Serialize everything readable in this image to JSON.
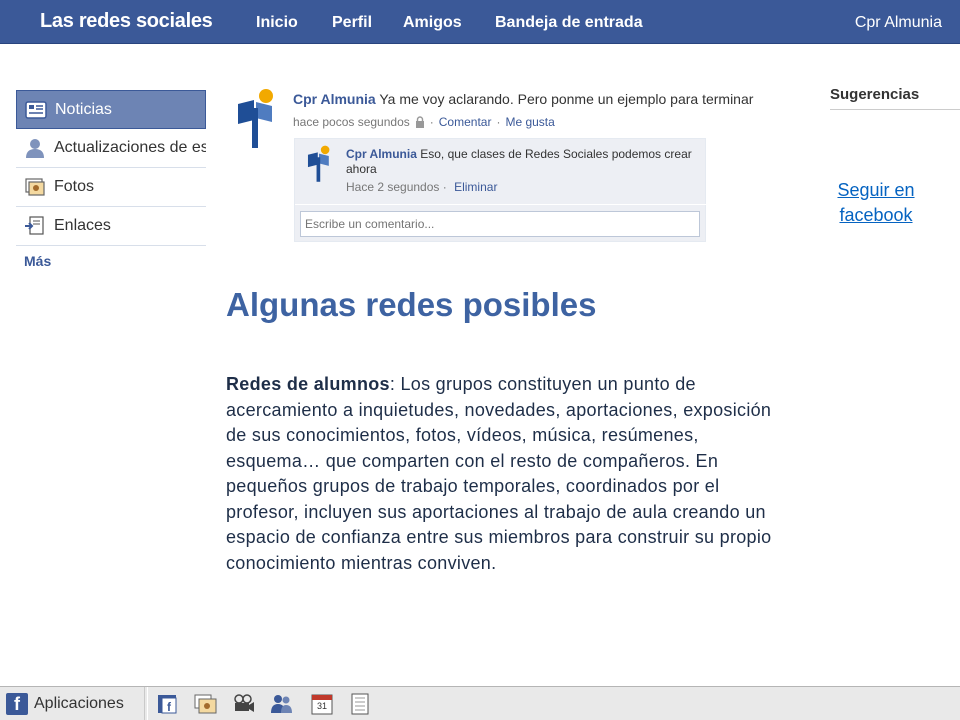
{
  "topbar": {
    "brand": "Las redes sociales",
    "nav": [
      "Inicio",
      "Perfil",
      "Amigos",
      "Bandeja de entrada"
    ],
    "user": "Cpr Almunia"
  },
  "sidebar": {
    "items": [
      {
        "label": "Noticias",
        "icon": "news-feed-icon",
        "active": true
      },
      {
        "label": "Actualizaciones de estado",
        "icon": "status-updates-icon",
        "active": false
      },
      {
        "label": "Fotos",
        "icon": "photos-icon",
        "active": false
      },
      {
        "label": "Enlaces",
        "icon": "links-icon",
        "active": false
      }
    ],
    "more": "Más"
  },
  "post": {
    "author": "Cpr Almunia",
    "text": "Ya me voy aclarando. Pero ponme un ejemplo para terminar",
    "time": "hace pocos segundos",
    "comment_link": "Comentar",
    "like_link": "Me gusta",
    "separator": "·",
    "comment": {
      "author": "Cpr Almunia",
      "text": "Eso, que clases de Redes Sociales podemos crear ahora",
      "time": "Hace 2 segundos",
      "separator": "·",
      "delete_link": "Eliminar"
    },
    "comment_placeholder": "Escribe un comentario..."
  },
  "right": {
    "suggestions_title": "Sugerencias",
    "follow_link": "Seguir en facebook"
  },
  "content": {
    "heading": "Algunas redes posibles",
    "body_bold": "Redes de alumnos",
    "body_text": ": Los grupos constituyen un punto de acercamiento a inquietudes, novedades, aportaciones, exposición de sus conocimientos, fotos, vídeos, música, resúmenes, esquema… que comparten con el resto de compañeros. En pequeños grupos de trabajo temporales, coordinados por el profesor, incluyen sus aportaciones al trabajo de aula creando un espacio de confianza entre sus miembros para construir su propio conocimiento mientras conviven."
  },
  "bottombar": {
    "apps_label": "Aplicaciones",
    "calendar_day": "31",
    "icons": [
      "facebook-app-icon",
      "photos-app-icon",
      "video-app-icon",
      "friends-app-icon",
      "events-calendar-icon",
      "notes-app-icon"
    ]
  },
  "colors": {
    "brand": "#3b5998",
    "active_item": "#6d84b4",
    "heading": "#3e63a2",
    "link": "#0563c1"
  }
}
